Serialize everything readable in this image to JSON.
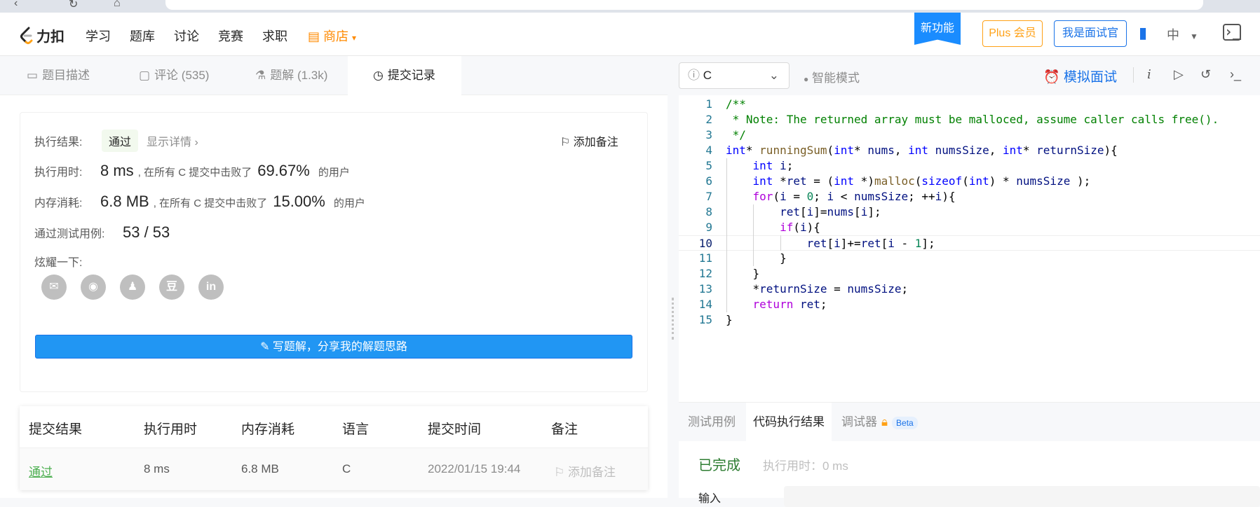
{
  "nav": {
    "logo_text": "力扣",
    "items": [
      "学习",
      "题库",
      "讨论",
      "竞赛",
      "求职"
    ],
    "store": "商店",
    "new_feature": "新功能",
    "plus": "Plus 会员",
    "interviewer": "我是面试官",
    "lang": "中"
  },
  "tabs": [
    {
      "label": "题目描述",
      "icon": "document-icon"
    },
    {
      "label": "评论 (535)",
      "icon": "comment-icon"
    },
    {
      "label": "题解 (1.3k)",
      "icon": "flask-icon"
    },
    {
      "label": "提交记录",
      "icon": "clock-icon"
    }
  ],
  "result": {
    "label_result": "执行结果:",
    "status": "通过",
    "detail": "显示详情 ›",
    "add_note": "添加备注",
    "label_time": "执行用时:",
    "time_value": "8 ms",
    "time_text": ", 在所有 C 提交中击败了",
    "time_pct": "69.67%",
    "label_mem": "内存消耗:",
    "mem_value": "6.8 MB",
    "mem_text": ", 在所有 C 提交中击败了",
    "mem_pct": "15.00%",
    "users": "的用户",
    "label_cases": "通过测试用例:",
    "cases": "53 / 53",
    "label_share": "炫耀一下:",
    "share": [
      "wechat-icon",
      "weibo-icon",
      "qq-icon",
      "douban-icon",
      "linkedin-icon"
    ],
    "share_glyphs": [
      "✉",
      "◉",
      "♟",
      "豆",
      "in"
    ],
    "write_button": "写题解，分享我的解题思路"
  },
  "submissions": {
    "headers": [
      "提交结果",
      "执行用时",
      "内存消耗",
      "语言",
      "提交时间",
      "备注"
    ],
    "rows": [
      {
        "result": "通过",
        "time": "8 ms",
        "memory": "6.8 MB",
        "lang": "C",
        "submitted": "2022/01/15 19:44",
        "note": "添加备注"
      }
    ]
  },
  "editor": {
    "language": "C",
    "smart_mode": "智能模式",
    "mock_interview": "模拟面试"
  },
  "bottom_tabs": {
    "testcase": "测试用例",
    "result": "代码执行结果",
    "debugger": "调试器",
    "beta": "Beta"
  },
  "run": {
    "status": "已完成",
    "exec_time": "执行用时：0 ms",
    "input_label": "输入"
  },
  "colors": {
    "accent": "#1a73e8",
    "store": "#ff8a00",
    "plus": "#ffa116",
    "pass": "#4caf50",
    "write_button": "#2196f3"
  }
}
